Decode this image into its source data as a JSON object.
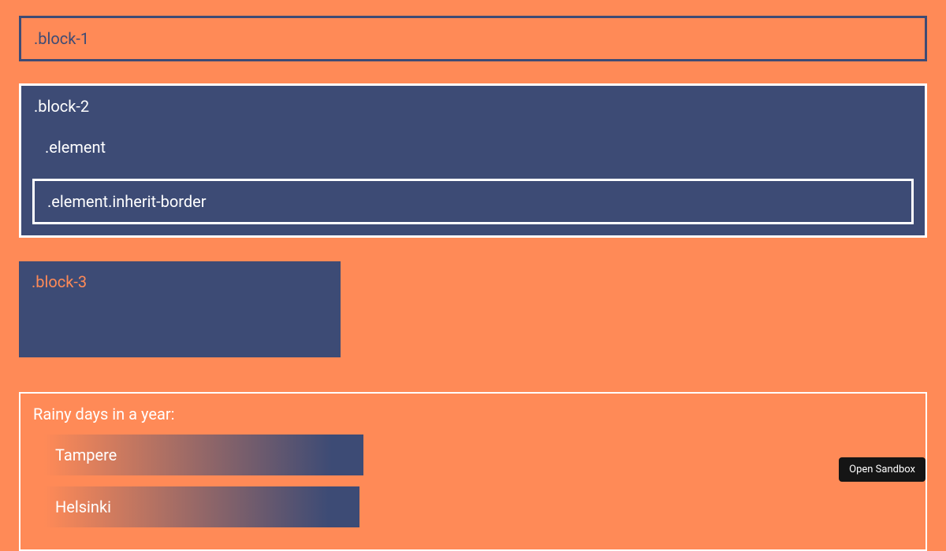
{
  "block1": {
    "label": ".block-1"
  },
  "block2": {
    "label": ".block-2",
    "element_label": ".element",
    "element_inherit_label": ".element.inherit-border"
  },
  "block3": {
    "label": ".block-3"
  },
  "chart": {
    "title": "Rainy days in a year:"
  },
  "chart_data": {
    "type": "bar",
    "title": "Rainy days in a year:",
    "categories": [
      "Tampere",
      "Helsinki"
    ],
    "values": [
      405,
      400
    ],
    "orientation": "horizontal"
  },
  "sandbox": {
    "button_label": "Open Sandbox"
  }
}
